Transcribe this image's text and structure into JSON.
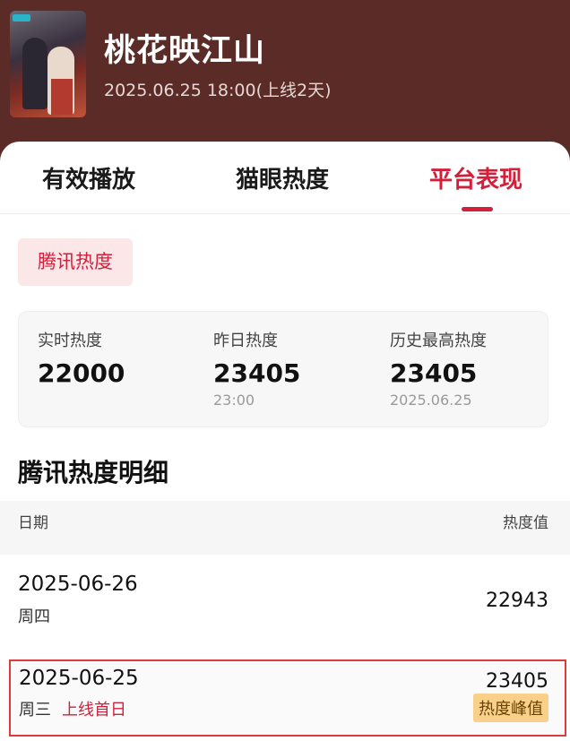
{
  "header": {
    "title": "桃花映江山",
    "subtitle": "2025.06.25 18:00(上线2天)"
  },
  "tabs": [
    {
      "label": "有效播放",
      "active": false
    },
    {
      "label": "猫眼热度",
      "active": false
    },
    {
      "label": "平台表现",
      "active": true
    }
  ],
  "accent_color": "#d21f3a",
  "header_bg": "#5b2c27",
  "platform_chip": "腾讯热度",
  "stats": [
    {
      "label": "实时热度",
      "value": "22000",
      "sub": ""
    },
    {
      "label": "昨日热度",
      "value": "23405",
      "sub": "23:00"
    },
    {
      "label": "历史最高热度",
      "value": "23405",
      "sub": "2025.06.25"
    }
  ],
  "detail": {
    "title": "腾讯热度明细",
    "col_date": "日期",
    "col_value": "热度值",
    "rows": [
      {
        "date": "2025-06-26",
        "weekday": "周四",
        "note": "",
        "value": "22943",
        "badge": ""
      },
      {
        "date": "2025-06-25",
        "weekday": "周三",
        "note": "上线首日",
        "value": "23405",
        "badge": "热度峰值"
      }
    ]
  }
}
